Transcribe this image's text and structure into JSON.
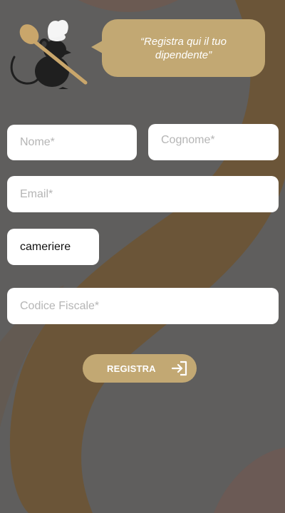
{
  "header": {
    "speech_bubble": "“Registra qui il tuo dipendente”",
    "mascot_icon": "chef-rat-with-spoon-icon"
  },
  "form": {
    "nome_placeholder": "Nome*",
    "cognome_placeholder": "Cognome*",
    "email_placeholder": "Email*",
    "ruolo_value": "cameriere",
    "codice_fiscale_placeholder": "Codice Fiscale*"
  },
  "actions": {
    "submit_label": "REGISTRA",
    "submit_icon": "login-arrow-icon"
  },
  "colors": {
    "accent": "#c2a873",
    "background": "#5f5e5d",
    "stripe": "#6b5538"
  }
}
